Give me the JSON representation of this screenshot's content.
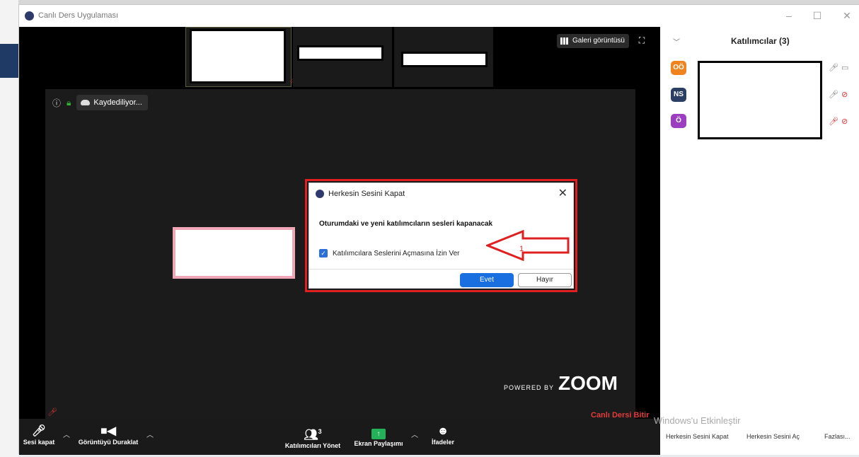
{
  "window": {
    "title": "Canlı Ders Uygulaması"
  },
  "controls": {
    "minimize": "–",
    "maximize": "☐",
    "close": "✕"
  },
  "top_bar": {
    "gallery_label": "Galeri görüntüsü"
  },
  "recording": {
    "label": "Kaydediliyor..."
  },
  "dialog": {
    "title": "Herkesin Sesini Kapat",
    "message": "Oturumdaki ve yeni katılımcıların sesleri kapanacak",
    "checkbox_label": "Katılımcılara Seslerini Açmasına İzin Ver",
    "checkbox_checked": true,
    "yes_label": "Evet",
    "no_label": "Hayır"
  },
  "annotation": {
    "number": "1",
    "color": "#e02020"
  },
  "branding": {
    "powered_by": "POWERED BY",
    "logo": "ZOOM"
  },
  "toolbar": {
    "mute_label": "Sesi kapat",
    "video_label": "Görüntüyü Duraklat",
    "participants_label": "Katılımcıları Yönet",
    "participants_count": "3",
    "share_label": "Ekran Paylaşımı",
    "reactions_label": "İfadeler",
    "end_label": "Canlı Dersi Bitir"
  },
  "participants_panel": {
    "header": "Katılımcılar (3)",
    "items": [
      {
        "initials": "OÖ",
        "color": "#f0831e"
      },
      {
        "initials": "NS",
        "color": "#2b3f63"
      },
      {
        "initials": "Ö",
        "color": "#9b3fc0"
      }
    ],
    "footer": {
      "mute_all": "Herkesin Sesini Kapat",
      "unmute_all": "Herkesin Sesini Aç",
      "more": "Fazlası..."
    }
  },
  "watermark": "Windows'u Etkinleştir"
}
